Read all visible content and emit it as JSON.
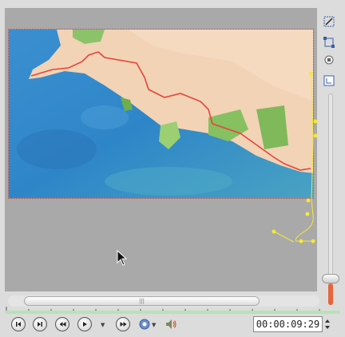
{
  "transport": {
    "timecode": "00:00:09:29"
  },
  "scrollbar": {
    "grip": "|||"
  },
  "colors": {
    "route": "#e8443a",
    "path_points": "#f3e83a",
    "zoom_fill": "#e8643a",
    "progress": "#b7e3b7"
  },
  "icons": {
    "tools": [
      "edit-path-icon",
      "transform-icon",
      "reset-icon",
      "keyframe-icon"
    ],
    "controls": [
      "start-icon",
      "end-icon",
      "rewind-icon",
      "play-icon",
      "forward-icon",
      "settings-icon",
      "volume-icon"
    ]
  }
}
